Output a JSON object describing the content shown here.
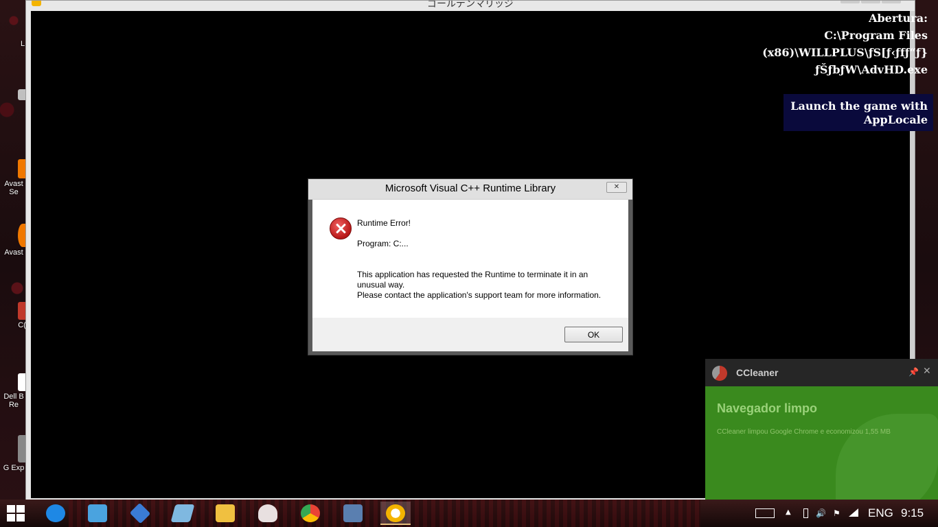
{
  "game_window": {
    "title": "ゴールデンマリッジ"
  },
  "overlay": {
    "path_label": "Abertura:",
    "path_line1": "C:\\Program Files",
    "path_line2": "(x86)\\WILLPLUS\\ƒS[ƒ‹ƒfƒ“ƒ}",
    "path_line3": "ƒŠƒbƒW\\AdvHD.exe",
    "launch_line1": "Launch the game with",
    "launch_line2": "AppLocale"
  },
  "dialog": {
    "title": "Microsoft Visual C++ Runtime Library",
    "close_glyph": "✕",
    "heading": "Runtime Error!",
    "program": "Program: C:...",
    "message_line1": "This application has requested the Runtime to terminate it in an",
    "message_line2": "unusual way.",
    "message_line3": "Please contact the application's support team for more information.",
    "ok_label": "OK"
  },
  "desktop_icons": [
    {
      "label": "L",
      "color": "#d0d0d0"
    },
    {
      "label": "",
      "color": "#c0c0c0"
    },
    {
      "label": "Avast Se",
      "color": "#f07800"
    },
    {
      "label": "Avast",
      "color": "#f07800"
    },
    {
      "label": "C(",
      "color": "#c0392b"
    },
    {
      "label": "Dell B Re",
      "color": "#ffffff"
    },
    {
      "label": "G Exp",
      "color": "#888888"
    }
  ],
  "ccleaner": {
    "app_name": "CCleaner",
    "pin_glyph": "📌",
    "close_glyph": "✕",
    "title": "Navegador limpo",
    "message": "CCleaner limpou Google Chrome e economizou 1,55 MB"
  },
  "taskbar": {
    "apps": [
      {
        "name": "internet-explorer",
        "color": "#1e88e5"
      },
      {
        "name": "control-panel",
        "color": "#4aa3df"
      },
      {
        "name": "ppsspp",
        "color": "#3a7bd5"
      },
      {
        "name": "notepad",
        "color": "#7fb8e0"
      },
      {
        "name": "file-explorer",
        "color": "#f0c040"
      },
      {
        "name": "anime-app",
        "color": "#e8e0e0"
      },
      {
        "name": "chrome",
        "color": "#34a853"
      },
      {
        "name": "on-screen-keyboard",
        "color": "#5a7fb0"
      },
      {
        "name": "game-app",
        "color": "#f4b400"
      }
    ],
    "language": "ENG",
    "clock": "9:15"
  }
}
